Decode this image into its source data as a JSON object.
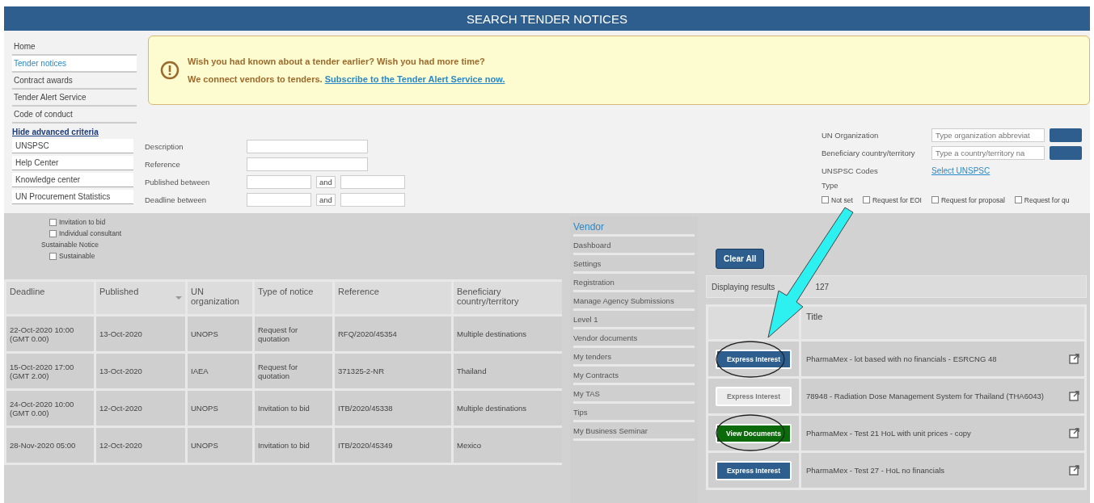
{
  "header": {
    "title": "SEARCH TENDER NOTICES"
  },
  "nav": [
    {
      "label": "Home",
      "selected": false
    },
    {
      "label": "Tender notices",
      "selected": true
    },
    {
      "label": "Contract awards",
      "selected": false
    },
    {
      "label": "Tender Alert Service",
      "selected": false
    },
    {
      "label": "Code of conduct",
      "selected": false
    }
  ],
  "banner": {
    "headline": "Wish you had known about a tender earlier? Wish you had more time?",
    "text": "We connect vendors to tenders.",
    "link": "Subscribe to the Tender Alert Service now."
  },
  "criteria": {
    "toggle_link": "Hide advanced criteria",
    "menu": [
      "UNSPSC",
      "Help Center",
      "Knowledge center",
      "UN Procurement Statistics"
    ],
    "fields": [
      {
        "label": "Description"
      },
      {
        "label": "Reference"
      }
    ],
    "ranges": [
      {
        "label": "Published between",
        "joiner": "and"
      },
      {
        "label": "Deadline between",
        "joiner": "and"
      }
    ],
    "lookups": [
      {
        "label": "UN Organization",
        "placeholder": "Type organization abbreviat"
      },
      {
        "label": "Beneficiary country/territory",
        "placeholder": "Type a country/territory na"
      }
    ],
    "unspsc": {
      "label": "UNSPSC Codes",
      "link": "Select UNSPSC"
    },
    "type": {
      "label": "Type",
      "options": [
        {
          "label": "Not set",
          "checked": false
        },
        {
          "label": "Request for EOI",
          "checked": false
        },
        {
          "label": "Request for proposal",
          "checked": false
        },
        {
          "label": "Request for qu",
          "checked": false
        }
      ]
    },
    "more_options": [
      {
        "label": "Invitation to bid",
        "checked": false
      },
      {
        "label": "Individual consultant",
        "checked": false
      }
    ],
    "sustainable": {
      "label": "Sustainable Notice",
      "options": [
        {
          "label": "Sustainable",
          "checked": false
        }
      ]
    },
    "clear_button": "Clear All"
  },
  "notices_table": {
    "columns": [
      "Deadline",
      "Published",
      "UN organization",
      "Type of notice",
      "Reference",
      "Beneficiary country/territory"
    ],
    "rows": [
      {
        "deadline": "22-Oct-2020 10:00",
        "deadline_zone": "(GMT 0.00)",
        "published": "13-Oct-2020",
        "organization": "UNOPS",
        "type": "Request for quotation",
        "reference": "RFQ/2020/45354",
        "country": "Multiple destinations"
      },
      {
        "deadline": "15-Oct-2020 17:00",
        "deadline_zone": "(GMT 2.00)",
        "published": "13-Oct-2020",
        "organization": "IAEA",
        "type": "Request for quotation",
        "reference": "371325-2-NR",
        "country": "Thailand"
      },
      {
        "deadline": "24-Oct-2020 10:00",
        "deadline_zone": "(GMT 0.00)",
        "published": "12-Oct-2020",
        "organization": "UNOPS",
        "type": "Invitation to bid",
        "reference": "ITB/2020/45338",
        "country": "Multiple destinations"
      },
      {
        "deadline": "28-Nov-2020 05:00",
        "published": "12-Oct-2020",
        "organization": "UNOPS",
        "type": "Invitation to bid",
        "reference": "ITB/2020/45349",
        "country": "Mexico"
      }
    ]
  },
  "vendor_menu": {
    "title": "Vendor",
    "items": [
      "Dashboard",
      "Settings",
      "Registration",
      "Manage Agency Submissions",
      "Level 1",
      "Vendor documents",
      "My tenders",
      "My Contracts",
      "My TAS",
      "Tips",
      "My Business Seminar"
    ]
  },
  "results": {
    "summary": "Displaying results",
    "count": "127",
    "columns": [
      "Title"
    ],
    "rows": [
      {
        "action": "Express Interest",
        "kind": "express",
        "disabled": false,
        "title": "PharmaMex - lot based with no financials - ESRCNG 48"
      },
      {
        "action": "Express Interest",
        "kind": "express",
        "disabled": true,
        "title": "78948 - Radiation Dose Management System for Thailand (THA6043)"
      },
      {
        "action": "View Documents",
        "kind": "view",
        "disabled": false,
        "title": "PharmaMex - Test 21 HoL with unit prices - copy"
      },
      {
        "action": "Express Interest",
        "kind": "express",
        "disabled": false,
        "title": "PharmaMex - Test 27 - HoL no financials"
      }
    ]
  }
}
